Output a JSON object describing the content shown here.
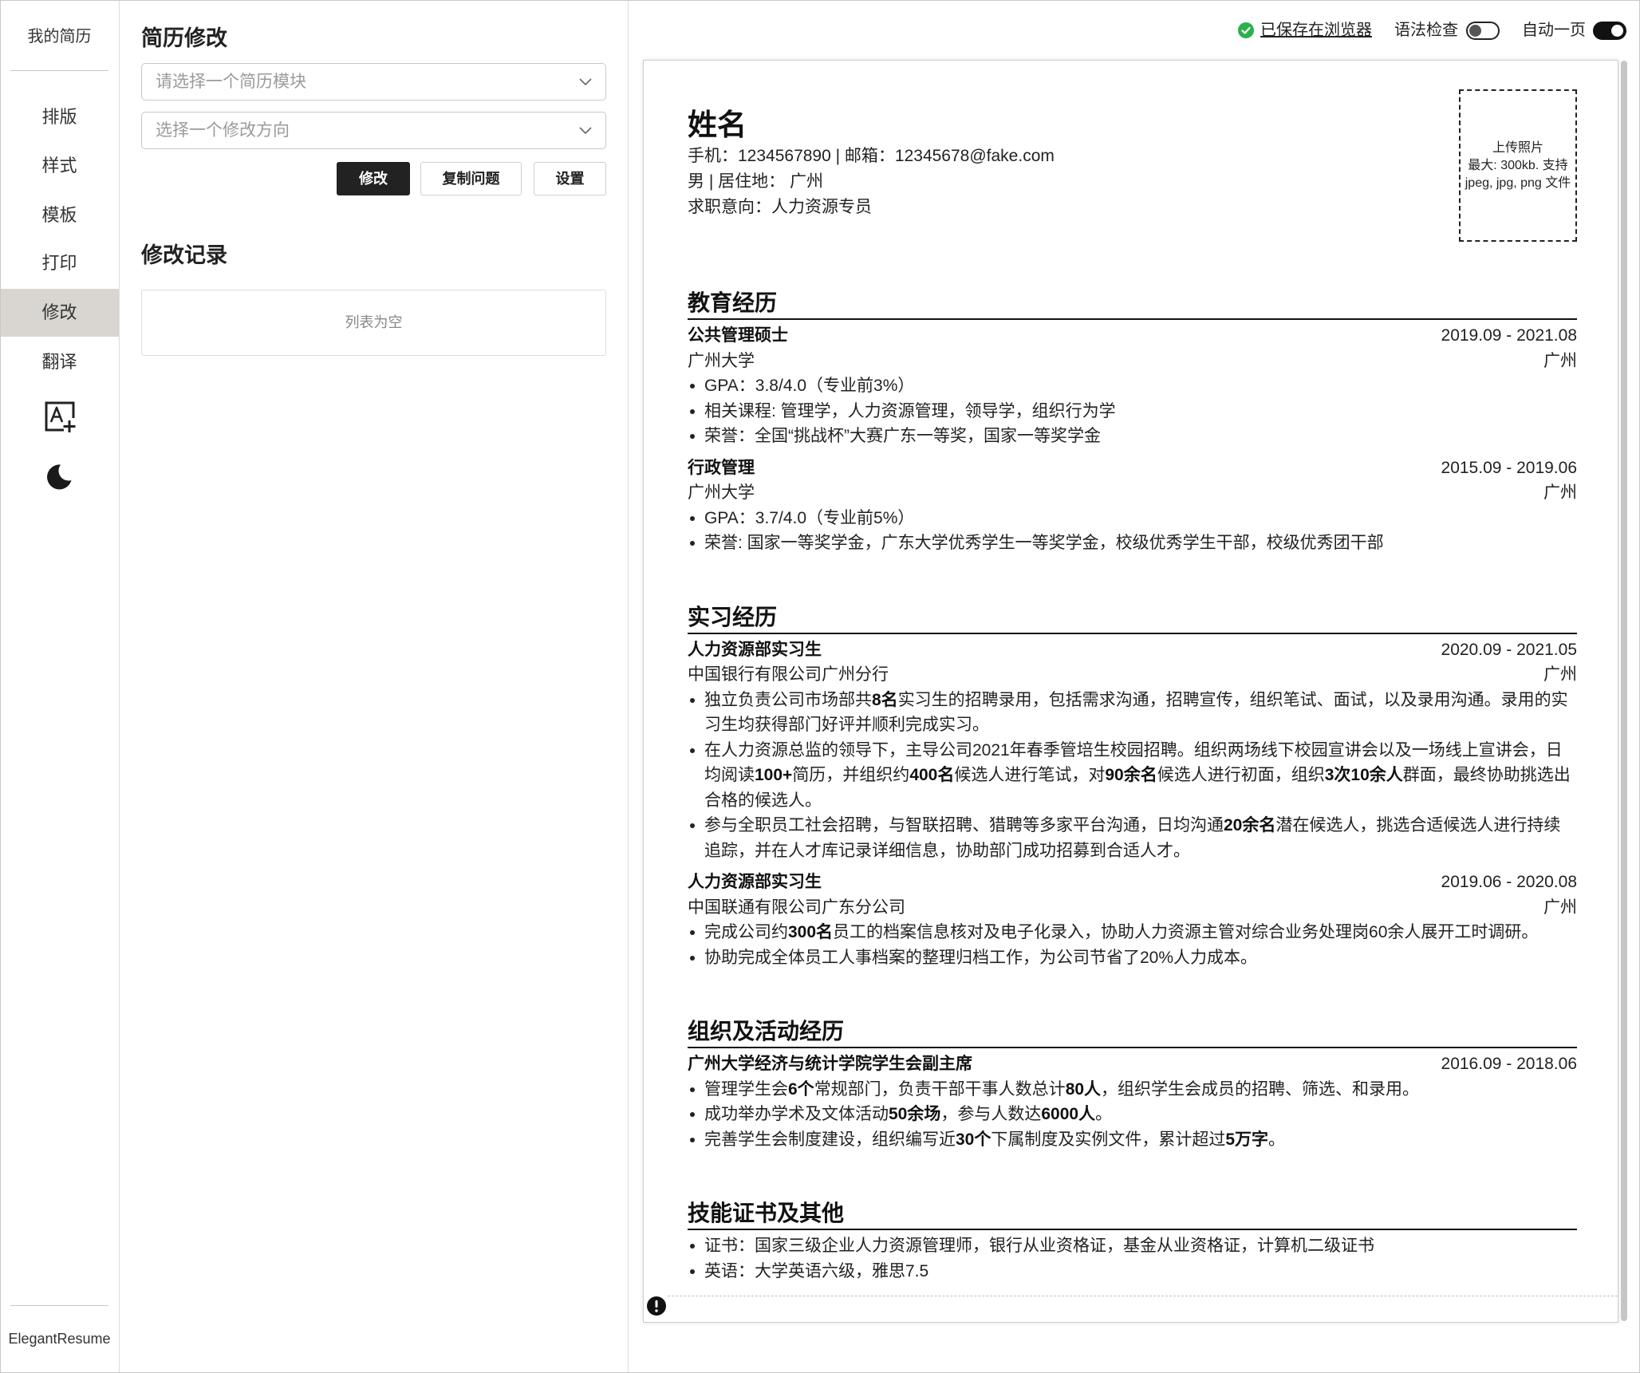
{
  "sidebar": {
    "title": "我的简历",
    "items": [
      {
        "label": "排版",
        "active": false
      },
      {
        "label": "样式",
        "active": false
      },
      {
        "label": "模板",
        "active": false
      },
      {
        "label": "打印",
        "active": false
      },
      {
        "label": "修改",
        "active": true
      },
      {
        "label": "翻译",
        "active": false
      }
    ],
    "icons": [
      "add-text-icon",
      "moon-icon"
    ],
    "footer": "ElegantResume"
  },
  "editor": {
    "title": "简历修改",
    "module_select": {
      "placeholder": "请选择一个简历模块",
      "value": ""
    },
    "direction_select": {
      "placeholder": "选择一个修改方向",
      "value": ""
    },
    "buttons": {
      "modify": "修改",
      "copy_question": "复制问题",
      "settings": "设置"
    },
    "history": {
      "title": "修改记录",
      "empty": "列表为空",
      "items": []
    }
  },
  "toolbar": {
    "saved_status": "已保存在浏览器",
    "saved_icon": "check-circle-icon",
    "grammar_check": {
      "label": "语法检查",
      "on": false
    },
    "auto_one_page": {
      "label": "自动一页",
      "on": true
    }
  },
  "resume": {
    "name": "姓名",
    "contact_lines": [
      "手机：1234567890 | 邮箱：12345678@fake.com",
      "男 | 居住地： 广州",
      "求职意向：人力资源专员"
    ],
    "photo": {
      "lines": [
        "上传照片",
        "最大: 300kb. 支持",
        "jpeg, jpg, png 文件"
      ]
    },
    "sections": [
      {
        "title": "教育经历",
        "items": [
          {
            "title": "公共管理硕士",
            "date": "2019.09 - 2021.08",
            "org": "广州大学",
            "location": "广州",
            "bullets": [
              [
                "GPA：3.8/4.0（专业前3%）"
              ],
              [
                "相关课程: 管理学，人力资源管理，领导学，组织行为学"
              ],
              [
                "荣誉：全国“挑战杯”大赛广东一等奖，国家一等奖学金"
              ]
            ]
          },
          {
            "title": "行政管理",
            "date": "2015.09 - 2019.06",
            "org": "广州大学",
            "location": "广州",
            "bullets": [
              [
                "GPA：3.7/4.0（专业前5%）"
              ],
              [
                "荣誉: 国家一等奖学金，广东大学优秀学生一等奖学金，校级优秀学生干部，校级优秀团干部"
              ]
            ]
          }
        ]
      },
      {
        "title": "实习经历",
        "items": [
          {
            "title": "人力资源部实习生",
            "date": "2020.09 - 2021.05",
            "org": "中国银行有限公司广州分行",
            "location": "广州",
            "bullets": [
              [
                "独立负责公司市场部共",
                {
                  "bold": "8名"
                },
                "实习生的招聘录用，包括需求沟通，招聘宣传，组织笔试、面试，以及录用沟通。录用的实习生均获得部门好评并顺利完成实习。"
              ],
              [
                "在人力资源总监的领导下，主导公司2021年春季管培生校园招聘。组织两场线下校园宣讲会以及一场线上宣讲会，日均阅读",
                {
                  "bold": "100+"
                },
                "简历，并组织约",
                {
                  "bold": "400名"
                },
                "候选人进行笔试，对",
                {
                  "bold": "90余名"
                },
                "候选人进行初面，组织",
                {
                  "bold": "3次10余人"
                },
                "群面，最终协助挑选出合格的候选人。"
              ],
              [
                "参与全职员工社会招聘，与智联招聘、猎聘等多家平台沟通，日均沟通",
                {
                  "bold": "20余名"
                },
                "潜在候选人，挑选合适候选人进行持续追踪，并在人才库记录详细信息，协助部门成功招募到合适人才。"
              ]
            ]
          },
          {
            "title": "人力资源部实习生",
            "date": "2019.06 - 2020.08",
            "org": "中国联通有限公司广东分公司",
            "location": "广州",
            "bullets": [
              [
                "完成公司约",
                {
                  "bold": "300名"
                },
                "员工的档案信息核对及电子化录入，协助人力资源主管对综合业务处理岗60余人展开工时调研。"
              ],
              [
                "协助完成全体员工人事档案的整理归档工作，为公司节省了20%人力成本。"
              ]
            ]
          }
        ]
      },
      {
        "title": "组织及活动经历",
        "items": [
          {
            "title": "广州大学经济与统计学院学生会副主席",
            "date": "2016.09 - 2018.06",
            "bullets": [
              [
                "管理学生会",
                {
                  "bold": "6个"
                },
                "常规部门，负责干部干事人数总计",
                {
                  "bold": "80人"
                },
                "，组织学生会成员的招聘、筛选、和录用。"
              ],
              [
                "成功举办学术及文体活动",
                {
                  "bold": "50余场"
                },
                "，参与人数达",
                {
                  "bold": "6000人"
                },
                "。"
              ],
              [
                "完善学生会制度建设，组织编写近",
                {
                  "bold": "30个"
                },
                "下属制度及实例文件，累计超过",
                {
                  "bold": "5万字"
                },
                "。"
              ]
            ]
          }
        ]
      },
      {
        "title": "技能证书及其他",
        "bullets": [
          [
            "证书：国家三级企业人力资源管理师，银行从业资格证，基金从业资格证，计算机二级证书"
          ],
          [
            "英语：大学英语六级，雅思7.5"
          ]
        ]
      }
    ]
  },
  "colors": {
    "text": "#222222",
    "active_nav_bg": "#d9d6d1",
    "saved_check": "#2bb14a",
    "primary_button": "#222222",
    "border": "#cccccc"
  }
}
